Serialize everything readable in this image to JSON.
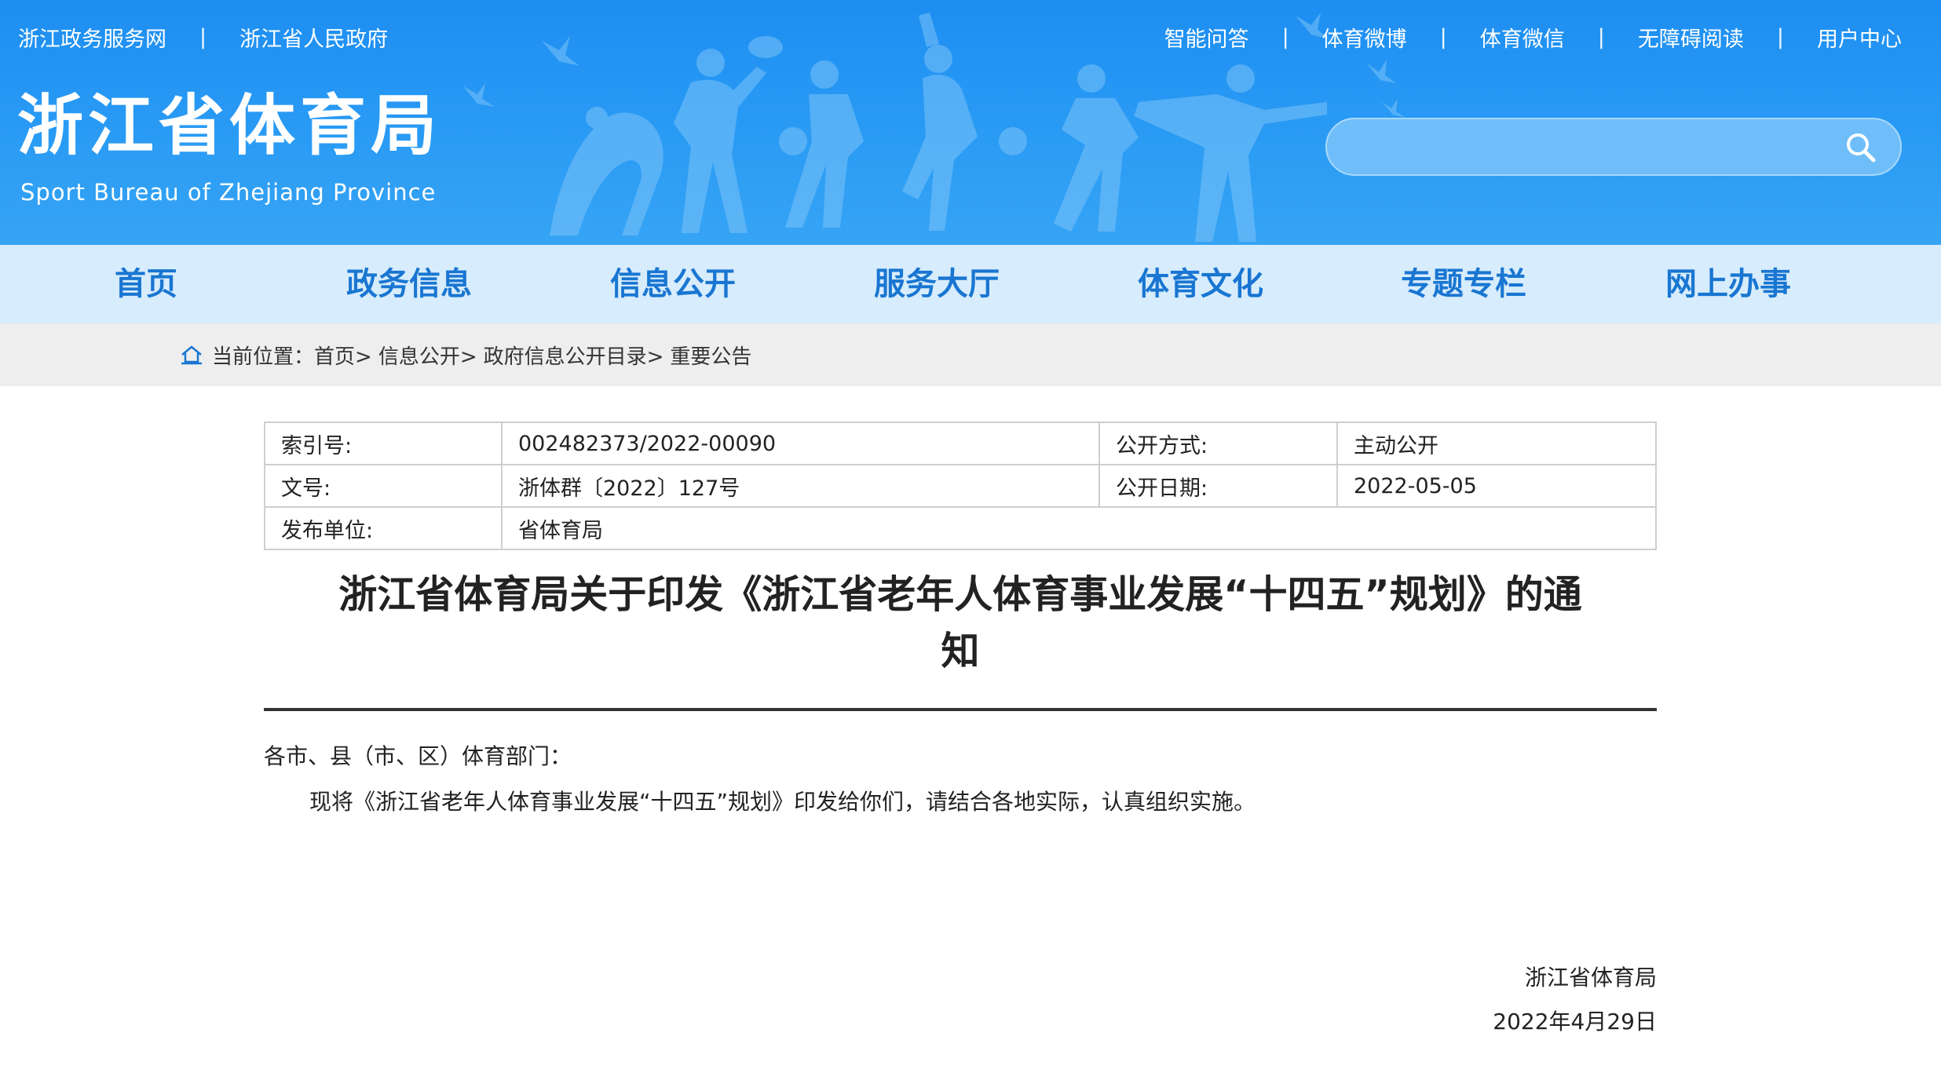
{
  "header": {
    "top_left_links": [
      "浙江政务服务网",
      "浙江省人民政府"
    ],
    "top_right_links": [
      "智能问答",
      "体育微博",
      "体育微信",
      "无障碍阅读",
      "用户中心"
    ],
    "separator": "|",
    "logo_cn": "浙江省体育局",
    "logo_en": "Sport Bureau of Zhejiang Province",
    "search_value": ""
  },
  "nav": {
    "items": [
      "首页",
      "政务信息",
      "信息公开",
      "服务大厅",
      "体育文化",
      "专题专栏",
      "网上办事"
    ]
  },
  "breadcrumb": {
    "label": "当前位置：",
    "items": [
      "首页>",
      "信息公开>",
      "政府信息公开目录>",
      "重要公告"
    ]
  },
  "meta": {
    "index_label": "索引号:",
    "index_value": "002482373/2022-00090",
    "method_label": "公开方式:",
    "method_value": "主动公开",
    "doc_label": "文号:",
    "doc_value": "浙体群〔2022〕127号",
    "date_label": "公开日期:",
    "date_value": "2022-05-05",
    "unit_label": "发布单位:",
    "unit_value": "省体育局"
  },
  "article": {
    "title_line1": "浙江省体育局关于印发《浙江省老年人体育事业发展“十四五”规划》的通",
    "title_line2": "知",
    "salutation": "各市、县（市、区）体育部门：",
    "body": "现将《浙江省老年人体育事业发展“十四五”规划》印发给你们，请结合各地实际，认真组织实施。",
    "signature": "浙江省体育局",
    "date": "2022年4月29日"
  },
  "colors": {
    "banner": "#2a9bf4",
    "nav_bg": "#d7ecfc",
    "nav_text": "#1976d2",
    "crumb_bg": "#eeeeee"
  }
}
